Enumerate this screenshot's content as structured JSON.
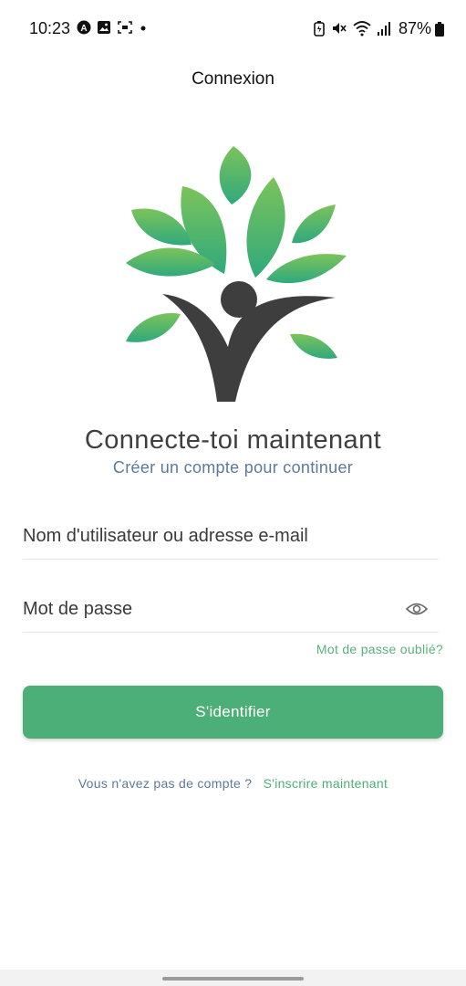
{
  "status": {
    "time": "10:23",
    "battery": "87%",
    "left_icons": [
      "a-circle-icon",
      "image-icon",
      "screenshot-icon",
      "dot-icon"
    ],
    "right_icons": [
      "battery-saver-icon",
      "mute-icon",
      "wifi-icon",
      "signal-icon"
    ]
  },
  "header": {
    "title": "Connexion"
  },
  "hero": {
    "headline": "Connecte-toi maintenant",
    "subline": "Créer un compte pour continuer"
  },
  "form": {
    "username_placeholder": "Nom d'utilisateur ou adresse e-mail",
    "username_value": "",
    "password_placeholder": "Mot de passe",
    "password_value": "",
    "forgot_label": "Mot de passe oublié?",
    "submit_label": "S'identifier"
  },
  "footer": {
    "prompt": "Vous n'avez pas de compte ?",
    "signup_label": "S'inscrire maintenant"
  },
  "colors": {
    "accent": "#4caf78",
    "secondary_text": "#5d7a98",
    "logo_dark": "#3e3e3e"
  }
}
